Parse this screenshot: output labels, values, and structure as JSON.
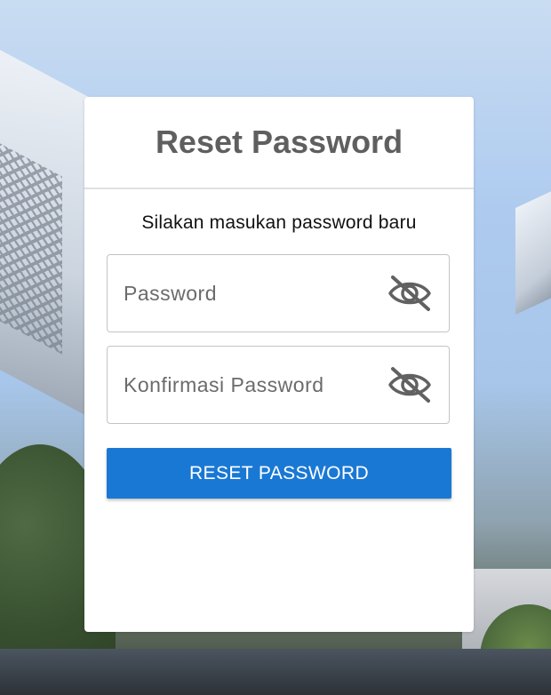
{
  "card": {
    "title": "Reset Password",
    "subtitle": "Silakan masukan password baru"
  },
  "fields": [
    {
      "placeholder": "Password",
      "value": "",
      "toggle_icon": "eye-off-icon"
    },
    {
      "placeholder": "Konfirmasi Password",
      "value": "",
      "toggle_icon": "eye-off-icon"
    }
  ],
  "submit": {
    "label": "RESET PASSWORD"
  },
  "colors": {
    "accent": "#1a78d5",
    "title": "#5f5f5f",
    "border": "#c4c4c4",
    "icon": "#616161"
  }
}
